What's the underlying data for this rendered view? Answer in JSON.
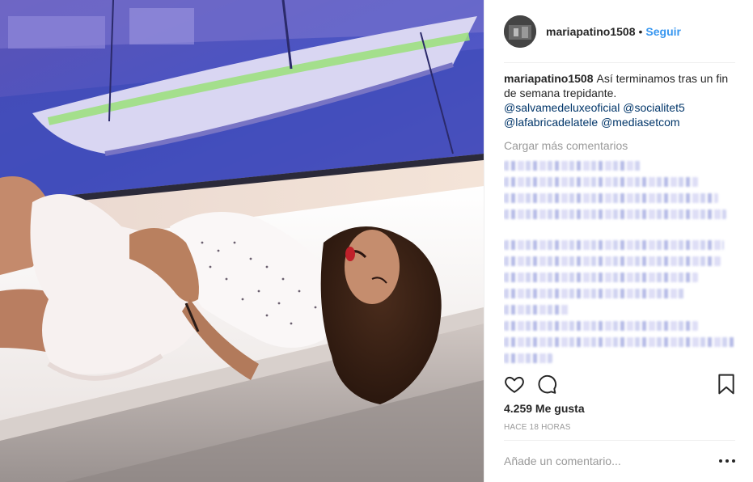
{
  "header": {
    "username": "mariapatino1508",
    "separator": "•",
    "follow_label": "Seguir"
  },
  "caption": {
    "username": "mariapatino1508",
    "text": "Así terminamos tras un fin de semana trepidante.",
    "mentions": [
      "@salvamedeluxeoficial",
      "@socialitet5",
      "@lafabricadelatele",
      "@mediasetcom"
    ]
  },
  "comments": {
    "load_more_label": "Cargar más comentarios",
    "blurred_rows": 12
  },
  "actions": {
    "like_icon": "heart-outline-icon",
    "comment_icon": "speech-bubble-icon",
    "save_icon": "bookmark-icon"
  },
  "stats": {
    "likes": "4.259 Me gusta",
    "timestamp": "HACE 18 HORAS"
  },
  "add_comment": {
    "placeholder": "Añade un comentario...",
    "more_label": "•••"
  },
  "colors": {
    "link": "#3897f0",
    "mention": "#003569",
    "muted": "#999999",
    "text": "#262626",
    "divider": "#efefef"
  }
}
